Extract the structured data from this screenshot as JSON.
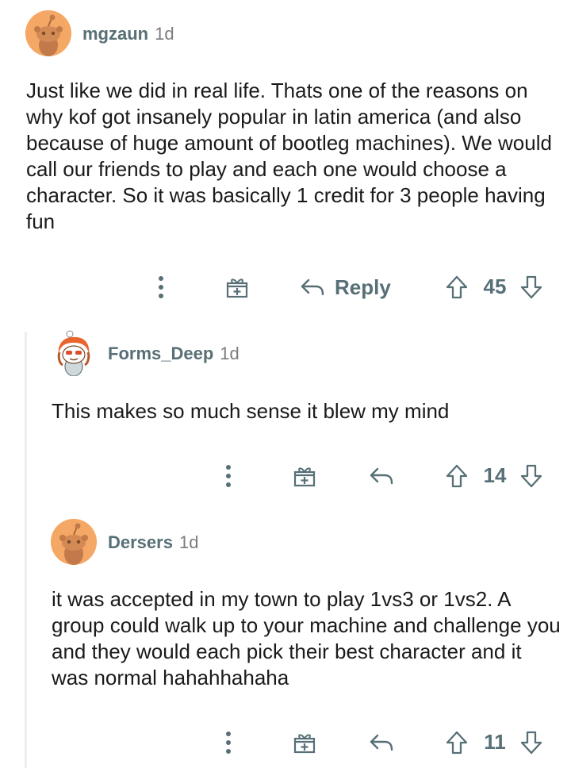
{
  "comments": [
    {
      "username": "mgzaun",
      "time": "1d",
      "body": "Just like we did in real life. Thats one of the reasons on why kof got insanely popular in latin america (and also because of huge amount of bootleg machines). We would call our friends to play and each one would choose a character. So it was basically 1 credit for 3 people having fun",
      "reply_label": "Reply",
      "score": "45",
      "avatar_icon": "snoo-avatar-icon"
    },
    {
      "username": "Forms_Deep",
      "time": "1d",
      "body": "This makes so much sense it blew my mind",
      "score": "14",
      "avatar_icon": "custom-snoo-avatar-icon"
    },
    {
      "username": "Dersers",
      "time": "1d",
      "body": "it was accepted in my town to play 1vs3 or 1vs2. A group could walk up to your machine and challenge you and they would each pick their best character and it was normal hahahhahaha",
      "score": "11",
      "avatar_icon": "snoo-avatar-icon"
    }
  ],
  "colors": {
    "avatar_bg": "#f5a865",
    "meta": "#576f76",
    "thread_line": "#edeff1"
  }
}
